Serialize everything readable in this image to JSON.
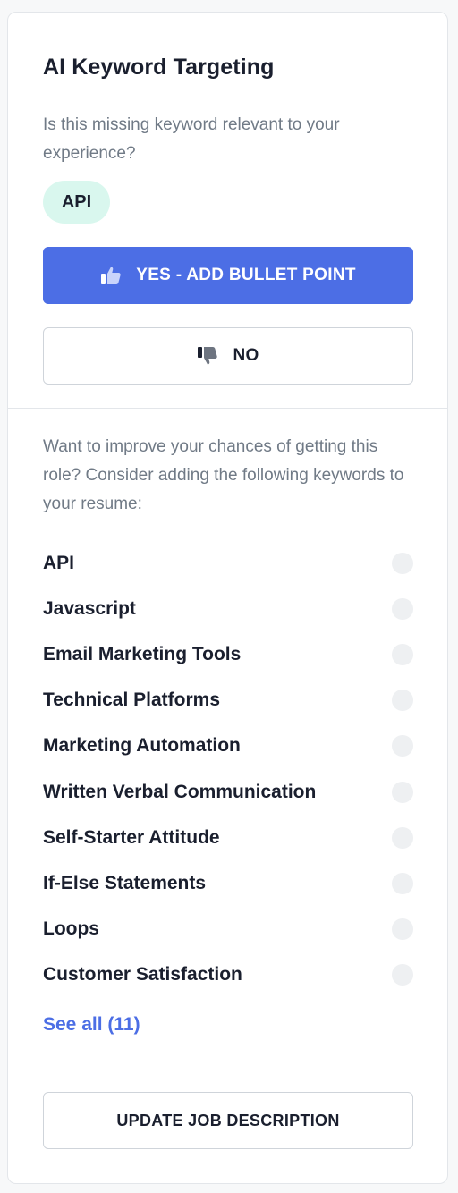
{
  "card": {
    "title": "AI Keyword Targeting",
    "question": "Is this missing keyword relevant to your experience?",
    "keyword_chip": "API",
    "yes_label": "YES - ADD BULLET POINT",
    "no_label": "NO",
    "improve_text": "Want to improve your chances of getting this role? Consider adding the following keywords to your resume:",
    "keywords": [
      {
        "label": "API"
      },
      {
        "label": "Javascript"
      },
      {
        "label": "Email Marketing Tools"
      },
      {
        "label": "Technical Platforms"
      },
      {
        "label": "Marketing Automation"
      },
      {
        "label": "Written Verbal Communication"
      },
      {
        "label": "Self-Starter Attitude"
      },
      {
        "label": "If-Else Statements"
      },
      {
        "label": "Loops"
      },
      {
        "label": "Customer Satisfaction"
      }
    ],
    "see_all_label": "See all (11)",
    "update_label": "UPDATE JOB DESCRIPTION"
  },
  "icons": {
    "yes_icon": "thumbs-up-icon",
    "no_icon": "thumbs-down-icon",
    "keyword_status_icon": "empty-circle-icon"
  },
  "colors": {
    "accent": "#4c6ee5",
    "chip_bg": "#d9f7ee",
    "muted_text": "#707a86"
  }
}
